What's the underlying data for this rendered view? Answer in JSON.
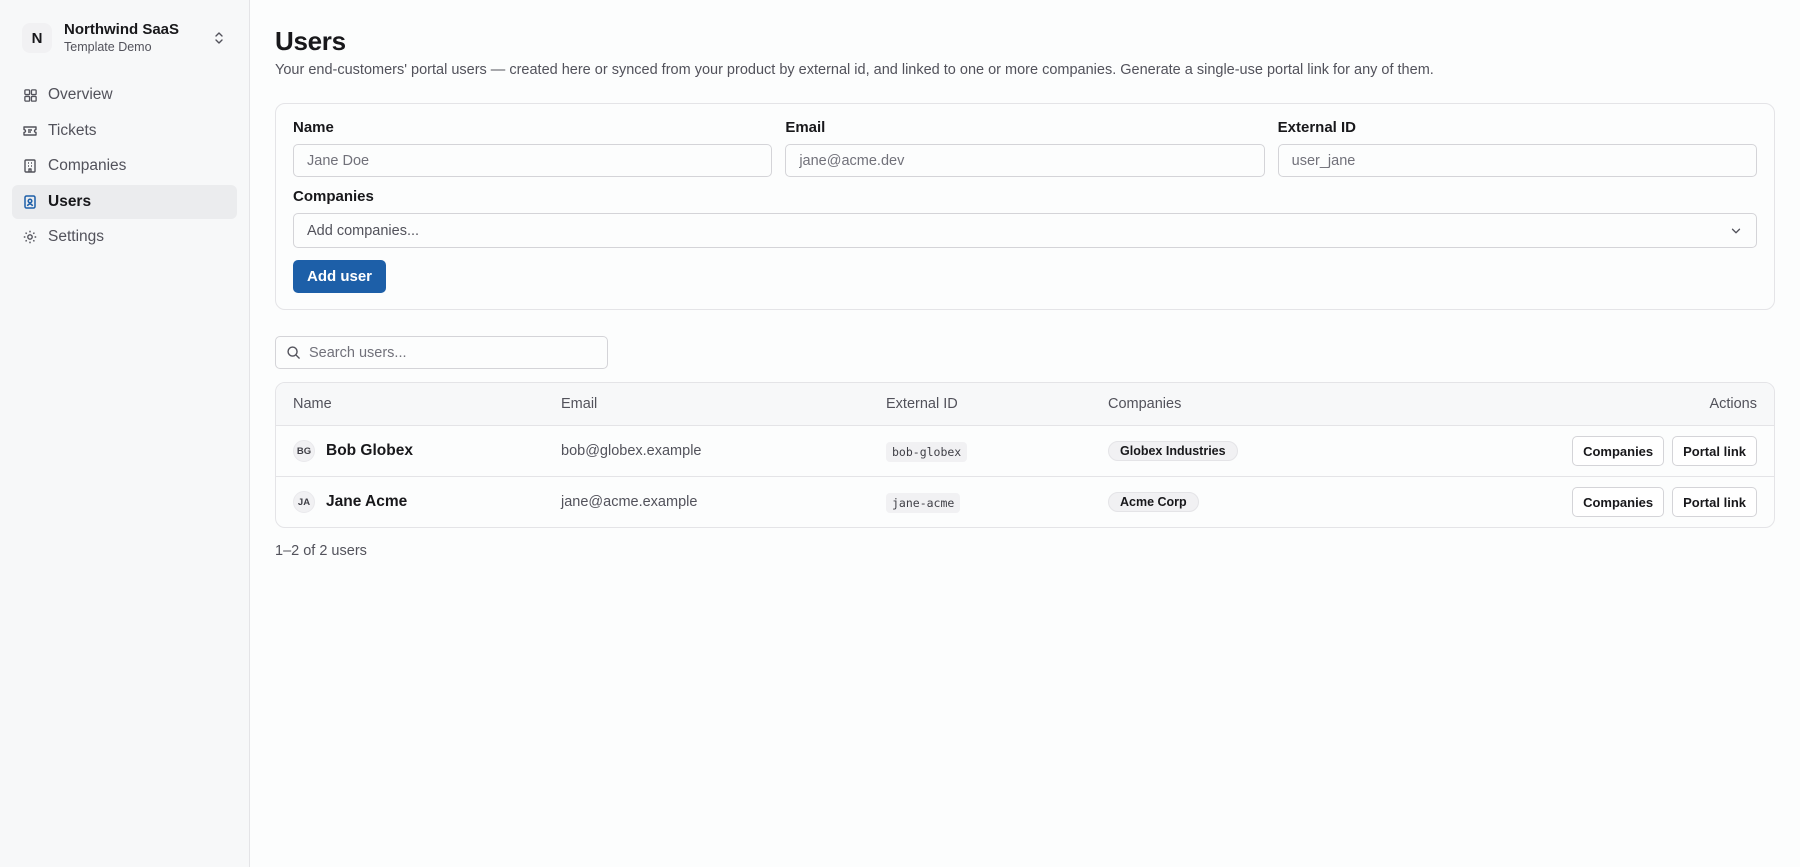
{
  "workspace": {
    "initial": "N",
    "name": "Northwind SaaS",
    "subtitle": "Template Demo"
  },
  "sidebar": {
    "items": [
      {
        "label": "Overview",
        "icon": "grid-icon",
        "active": false
      },
      {
        "label": "Tickets",
        "icon": "ticket-icon",
        "active": false
      },
      {
        "label": "Companies",
        "icon": "building-icon",
        "active": false
      },
      {
        "label": "Users",
        "icon": "user-badge-icon",
        "active": true
      },
      {
        "label": "Settings",
        "icon": "gear-icon",
        "active": false
      }
    ]
  },
  "page": {
    "title": "Users",
    "description": "Your end-customers' portal users — created here or synced from your product by external id, and linked to one or more companies. Generate a single-use portal link for any of them."
  },
  "form": {
    "name_label": "Name",
    "name_placeholder": "Jane Doe",
    "email_label": "Email",
    "email_placeholder": "jane@acme.dev",
    "external_id_label": "External ID",
    "external_id_placeholder": "user_jane",
    "companies_label": "Companies",
    "companies_placeholder": "Add companies...",
    "submit_label": "Add user"
  },
  "search": {
    "placeholder": "Search users..."
  },
  "table": {
    "columns": {
      "name": "Name",
      "email": "Email",
      "external_id": "External ID",
      "companies": "Companies",
      "actions": "Actions"
    },
    "rows": [
      {
        "initials": "BG",
        "name": "Bob Globex",
        "email": "bob@globex.example",
        "external_id": "bob-globex",
        "company": "Globex Industries",
        "companies_button": "Companies",
        "portal_button": "Portal link"
      },
      {
        "initials": "JA",
        "name": "Jane Acme",
        "email": "jane@acme.example",
        "external_id": "jane-acme",
        "company": "Acme Corp",
        "companies_button": "Companies",
        "portal_button": "Portal link"
      }
    ]
  },
  "pagination": {
    "text": "1–2 of 2 users"
  },
  "colors": {
    "accent": "#1d5fa8",
    "sidebar_bg": "#f7f8f9",
    "active_item_bg": "#ebecee"
  }
}
